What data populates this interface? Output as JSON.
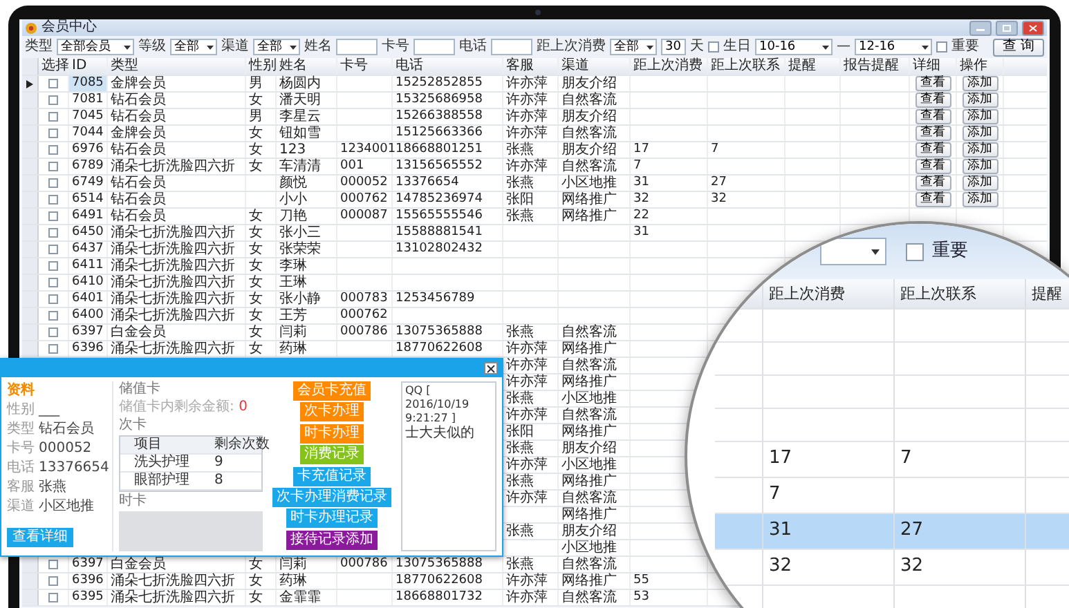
{
  "window": {
    "title": "会员中心"
  },
  "filters": [
    {
      "kind": "select",
      "label": "类型",
      "value": "全部会员"
    },
    {
      "kind": "select",
      "label": "等级",
      "value": "全部"
    },
    {
      "kind": "select",
      "label": "渠道",
      "value": "全部"
    },
    {
      "kind": "input",
      "label": "姓名"
    },
    {
      "kind": "input",
      "label": "卡号"
    },
    {
      "kind": "input",
      "label": "电话"
    },
    {
      "kind": "select",
      "label": "距上次消费",
      "value": "全部"
    },
    {
      "kind": "input",
      "value": "30",
      "suffix": "天"
    },
    {
      "kind": "checkbox",
      "label": "生日",
      "checked": false
    },
    {
      "kind": "select",
      "value": "10-16"
    },
    {
      "kind": "dash",
      "label": "—"
    },
    {
      "kind": "select",
      "value": "12-16"
    },
    {
      "kind": "checkbox",
      "label": "重要",
      "checked": false
    }
  ],
  "query_button": "查 询",
  "table": {
    "columns": [
      "选择",
      "ID",
      "类型",
      "性别",
      "姓名",
      "卡号",
      "电话",
      "客服",
      "渠道",
      "距上次消费",
      "距上次联系",
      "提醒",
      "报告提醒",
      "详细",
      "操作"
    ],
    "rows": [
      {
        "current": true,
        "checked": false,
        "id": "7085",
        "type": "金牌会员",
        "gender": "男",
        "name": "杨圆内",
        "phone": "15252852855",
        "agent": "许亦萍",
        "channel": "朋友介绍",
        "view": "查看",
        "add": "添加"
      },
      {
        "current": false,
        "checked": false,
        "id": "7081",
        "type": "钻石会员",
        "gender": "女",
        "name": "潘天明",
        "phone": "15325686958",
        "agent": "许亦萍",
        "channel": "自然客流",
        "view": "查看",
        "add": "添加"
      },
      {
        "current": false,
        "checked": false,
        "id": "7045",
        "type": "钻石会员",
        "gender": "男",
        "name": "李星云",
        "phone": "15266388558",
        "agent": "许亦萍",
        "channel": "朋友介绍",
        "view": "查看",
        "add": "添加"
      },
      {
        "current": false,
        "checked": false,
        "id": "7044",
        "type": "金牌会员",
        "gender": "女",
        "name": "钮如雪",
        "phone": "15125663366",
        "agent": "许亦萍",
        "channel": "自然客流",
        "view": "查看",
        "add": "添加"
      },
      {
        "current": false,
        "checked": false,
        "id": "6976",
        "type": "钻石会员",
        "gender": "女",
        "name": "123",
        "card": "1234001",
        "phone": "18668801251",
        "agent": "张燕",
        "channel": "朋友介绍",
        "since_purchase": "17",
        "since_contact": "7",
        "view": "查看",
        "add": "添加"
      },
      {
        "current": false,
        "checked": false,
        "id": "6789",
        "type": "涌朵七折洗脸四六折",
        "gender": "女",
        "name": "车清清",
        "card": "001",
        "phone": "13156565552",
        "agent": "许亦萍",
        "channel": "自然客流",
        "since_purchase": "7",
        "view": "查看",
        "add": "添加"
      },
      {
        "current": false,
        "checked": false,
        "id": "6749",
        "type": "钻石会员",
        "name": "颜悦",
        "card": "000052",
        "phone": "13376654",
        "agent": "张燕",
        "channel": "小区地推",
        "since_purchase": "31",
        "since_contact": "27",
        "view": "查看",
        "add": "添加"
      },
      {
        "current": false,
        "checked": false,
        "id": "6514",
        "type": "钻石会员",
        "name": "小小",
        "card": "000762",
        "phone": "14785236974",
        "agent": "张阳",
        "channel": "网络推广",
        "since_purchase": "32",
        "since_contact": "32",
        "view": "查看",
        "add": "添加"
      },
      {
        "current": false,
        "checked": false,
        "id": "6491",
        "type": "钻石会员",
        "gender": "女",
        "name": "刀艳",
        "card": "000087",
        "phone": "15565555546",
        "agent": "张燕",
        "channel": "网络推广",
        "since_purchase": "22"
      },
      {
        "current": false,
        "checked": false,
        "id": "6450",
        "type": "涌朵七折洗脸四六折",
        "gender": "女",
        "name": "张小三",
        "phone": "15588881541",
        "since_purchase": "31"
      },
      {
        "current": false,
        "checked": false,
        "id": "6437",
        "type": "涌朵七折洗脸四六折",
        "gender": "女",
        "name": "张荣荣",
        "phone": "13102802432"
      },
      {
        "current": false,
        "checked": false,
        "id": "6411",
        "type": "涌朵七折洗脸四六折",
        "gender": "女",
        "name": "李琳"
      },
      {
        "current": false,
        "checked": false,
        "id": "6410",
        "type": "涌朵七折洗脸四六折",
        "gender": "女",
        "name": "王琳"
      },
      {
        "current": false,
        "checked": false,
        "id": "6401",
        "type": "涌朵七折洗脸四六折",
        "gender": "女",
        "name": "张小静",
        "card": "000783",
        "phone": "1253456789"
      },
      {
        "current": false,
        "checked": false,
        "id": "6400",
        "type": "涌朵七折洗脸四六折",
        "gender": "女",
        "name": "王芳",
        "card": "000762"
      },
      {
        "current": false,
        "checked": false,
        "id": "6397",
        "type": "白金会员",
        "gender": "女",
        "name": "闫莉",
        "card": "000786",
        "phone": "13075365888",
        "agent": "张燕",
        "channel": "自然客流"
      },
      {
        "current": false,
        "checked": false,
        "id": "6396",
        "type": "涌朵七折洗脸四六折",
        "gender": "女",
        "name": "药琳",
        "phone": "18770622608",
        "agent": "许亦萍",
        "channel": "网络推广"
      },
      {
        "agent": "许亦萍",
        "channel": "自然客流"
      },
      {
        "agent": "许亦萍",
        "channel": "网络推广"
      },
      {
        "agent": "张燕",
        "channel": "小区地推"
      },
      {
        "agent": "许亦萍",
        "channel": "自然客流"
      },
      {
        "agent": "张阳",
        "channel": "网络推广"
      },
      {
        "agent": "张燕",
        "channel": "朋友介绍"
      },
      {
        "agent": "许亦萍",
        "channel": "小区地推"
      },
      {
        "agent": "张燕",
        "channel": "网络推广"
      },
      {
        "agent": "许亦萍",
        "channel": "自然客流"
      },
      {
        "channel": "网络推广"
      },
      {
        "agent": "张燕",
        "channel": "朋友介绍"
      },
      {
        "channel": "小区地推"
      },
      {
        "current": false,
        "checked": false,
        "id": "6397",
        "type": "白金会员",
        "gender": "女",
        "name": "闫莉",
        "card": "000786",
        "phone": "13075365888",
        "agent": "张燕",
        "channel": "自然客流"
      },
      {
        "current": false,
        "checked": false,
        "id": "6396",
        "type": "涌朵七折洗脸四六折",
        "gender": "女",
        "name": "药琳",
        "phone": "18770622608",
        "agent": "许亦萍",
        "channel": "网络推广",
        "since_purchase": "55"
      },
      {
        "current": false,
        "checked": false,
        "id": "6395",
        "type": "涌朵七折洗脸四六折",
        "gender": "女",
        "name": "金霏霏",
        "phone": "18668801732",
        "agent": "许亦萍",
        "channel": "自然客流",
        "since_purchase": "53"
      }
    ]
  },
  "member_dialog": {
    "profile_title": "资料",
    "profile": [
      {
        "label": "性别",
        "value": "___"
      },
      {
        "label": "类型",
        "value": "钻石会员"
      },
      {
        "label": "卡号",
        "value": "000052"
      },
      {
        "label": "电话",
        "value": "13376654"
      },
      {
        "label": "客服",
        "value": "张燕"
      },
      {
        "label": "渠道",
        "value": "小区地推"
      }
    ],
    "detail_button": "查看详细",
    "stored_card": {
      "title": "储值卡",
      "balance_label": "储值卡内剩余金额:",
      "balance": "0"
    },
    "count_card": {
      "title": "次卡",
      "columns": [
        "项目",
        "剩余次数"
      ],
      "rows": [
        [
          "洗头护理",
          "9"
        ],
        [
          "眼部护理",
          "8"
        ]
      ]
    },
    "time_card": {
      "title": "时卡"
    },
    "actions": [
      {
        "label": "会员卡充值",
        "color": "#ff8a00"
      },
      {
        "label": "次卡办理",
        "color": "#ff8a00"
      },
      {
        "label": "时卡办理",
        "color": "#ff8a00"
      },
      {
        "label": "消费记录",
        "color": "#86c21c"
      },
      {
        "label": "卡充值记录",
        "color": "#1ba8ea"
      },
      {
        "label": "次卡办理消费记录",
        "color": "#1ba8ea"
      },
      {
        "label": "时卡办理记录",
        "color": "#1ba8ea"
      },
      {
        "label": "接待记录添加",
        "color": "#8b1a9c"
      }
    ],
    "log": [
      "QQ [ 2016/10/19 9:21:27 ]",
      "士大夫似的"
    ]
  },
  "magnifier": {
    "important": {
      "label": "重要",
      "checked": false
    },
    "columns": [
      "距上次消费",
      "距上次联系",
      "提醒"
    ],
    "rows": [
      {
        "selected": false
      },
      {
        "selected": false
      },
      {
        "selected": false
      },
      {
        "selected": false
      },
      {
        "selected": false,
        "since_purchase": "17",
        "since_contact": "7"
      },
      {
        "selected": false,
        "since_purchase": "7"
      },
      {
        "selected": true,
        "since_purchase": "31",
        "since_contact": "27"
      },
      {
        "selected": false,
        "since_purchase": "32",
        "since_contact": "32"
      },
      {
        "selected": false
      }
    ]
  }
}
